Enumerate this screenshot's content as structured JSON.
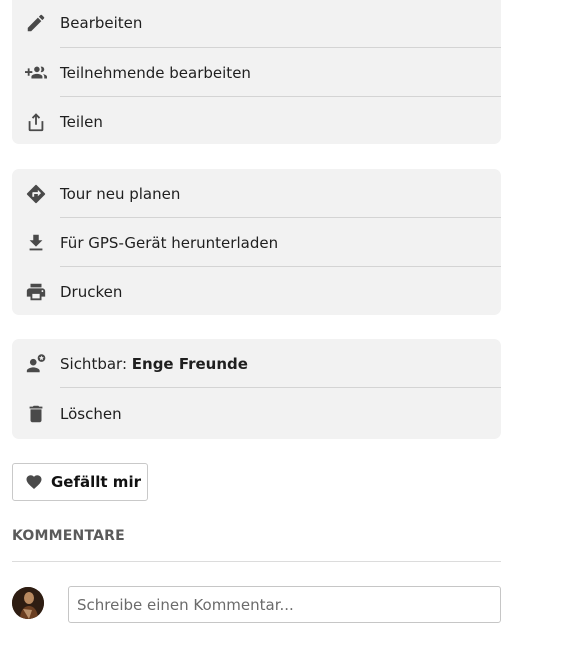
{
  "menu_group_1": {
    "items": [
      {
        "label": "Bearbeiten",
        "icon": "pencil-icon"
      },
      {
        "label": "Teilnehmende bearbeiten",
        "icon": "add-people-icon"
      },
      {
        "label": "Teilen",
        "icon": "share-icon"
      }
    ]
  },
  "menu_group_2": {
    "items": [
      {
        "label": "Tour neu planen",
        "icon": "route-turn-icon"
      },
      {
        "label": "Für GPS-Gerät herunterladen",
        "icon": "download-icon"
      },
      {
        "label": "Drucken",
        "icon": "printer-icon"
      }
    ]
  },
  "menu_group_3": {
    "visibility": {
      "prefix": "Sichtbar: ",
      "value": "Enge Freunde",
      "icon": "person-star-icon"
    },
    "delete": {
      "label": "Löschen",
      "icon": "trash-icon"
    }
  },
  "like_button": {
    "label": "Gefällt mir",
    "icon": "heart-icon"
  },
  "comments": {
    "heading": "KOMMENTARE",
    "input_placeholder": "Schreibe einen Kommentar..."
  },
  "colors": {
    "card_background": "#f2f2f2",
    "icon": "#4a4a4a",
    "divider": "#d4d4d4"
  }
}
